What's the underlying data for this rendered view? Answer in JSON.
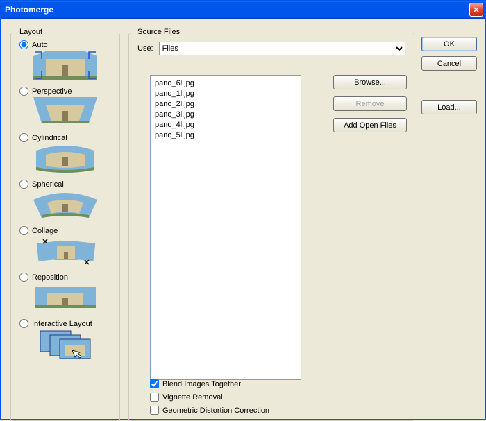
{
  "title": "Photomerge",
  "layout": {
    "legend": "Layout",
    "options": [
      {
        "label": "Auto",
        "checked": true,
        "name": "layout-auto"
      },
      {
        "label": "Perspective",
        "checked": false,
        "name": "layout-perspective"
      },
      {
        "label": "Cylindrical",
        "checked": false,
        "name": "layout-cylindrical"
      },
      {
        "label": "Spherical",
        "checked": false,
        "name": "layout-spherical"
      },
      {
        "label": "Collage",
        "checked": false,
        "name": "layout-collage"
      },
      {
        "label": "Reposition",
        "checked": false,
        "name": "layout-reposition"
      },
      {
        "label": "Interactive Layout",
        "checked": false,
        "name": "layout-interactive"
      }
    ]
  },
  "source": {
    "legend": "Source Files",
    "use_label": "Use:",
    "use_value": "Files",
    "files": [
      "pano_6l.jpg",
      "pano_1l.jpg",
      "pano_2l.jpg",
      "pano_3l.jpg",
      "pano_4l.jpg",
      "pano_5l.jpg"
    ],
    "browse": "Browse...",
    "remove": "Remove",
    "add_open": "Add Open Files",
    "blend": "Blend Images Together",
    "vignette": "Vignette Removal",
    "geometric": "Geometric Distortion Correction",
    "blend_checked": true,
    "vignette_checked": false,
    "geometric_checked": false
  },
  "buttons": {
    "ok": "OK",
    "cancel": "Cancel",
    "load": "Load..."
  }
}
